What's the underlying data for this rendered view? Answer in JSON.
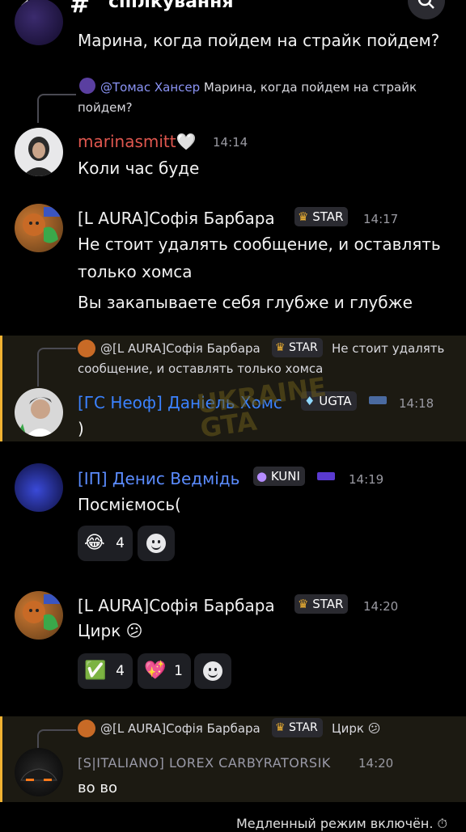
{
  "header": {
    "channel_name": "спілкування",
    "back_icon": "‹",
    "hash_icon": "#"
  },
  "messages": {
    "m0": {
      "text": "Марина, когда пойдем на страйк пойдем?"
    },
    "m1": {
      "reply_mention": "@Томас Хансер",
      "reply_text_1": "Марина, когда пойдем на страйк",
      "reply_text_2": "пойдем?",
      "author": "marinasmitt🤍",
      "author_color": "#e0574f",
      "time": "14:14",
      "text": "Коли час буде"
    },
    "m2": {
      "author": "[L AURA]Софія Барбара",
      "badge": "STAR",
      "time": "14:17",
      "text_1": "Не стоит удалять сообщение, и оставлять",
      "text_2": "только хомса",
      "text_3": "Вы закапываете себя глубже и глубже"
    },
    "m3": {
      "reply_author": "@[L AURA]Софія Барбара",
      "reply_badge": "STAR",
      "reply_text_1": "Не стоит удалять",
      "reply_text_2": "сообщение, и оставлять только хомса",
      "author": "[ГС Неоф]  Даніель Хомс",
      "author_color": "#3b82ff",
      "badge": "UGTA",
      "time": "14:18",
      "text": ")"
    },
    "m4": {
      "author": "[ІП] Денис Ведмідь",
      "author_color": "#5b8cff",
      "badge": "KUNI",
      "time": "14:19",
      "text": "Посміємось(",
      "reactions": [
        {
          "emoji": "😂",
          "count": "4"
        }
      ]
    },
    "m5": {
      "author": "[L AURA]Софія Барбара",
      "badge": "STAR",
      "time": "14:20",
      "text": "Цирк 😕",
      "reactions": [
        {
          "emoji": "✅",
          "count": "4"
        },
        {
          "emoji": "💖",
          "count": "1"
        }
      ]
    },
    "m6": {
      "reply_author": "@[L AURA]Софія Барбара",
      "reply_badge": "STAR",
      "reply_text": "Цирк 😕",
      "author": "[S|ITALIANO] LOREX CARBYRATORSIK",
      "author_color": "#9a9aa8",
      "time": "14:20",
      "text": "во во"
    }
  },
  "watermark": "UKRAINE GTA",
  "footer": {
    "slow_mode": "Медленный режим включён."
  }
}
